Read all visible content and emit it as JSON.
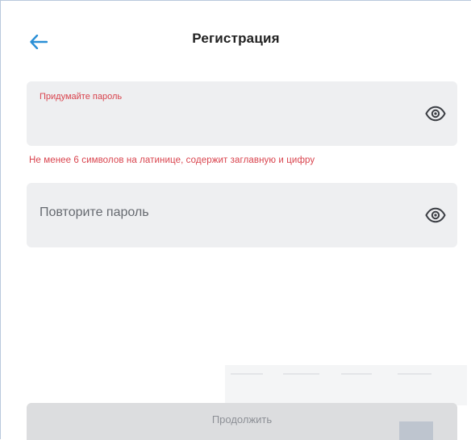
{
  "header": {
    "title": "Регистрация"
  },
  "password_field": {
    "label": "Придумайте пароль",
    "value": ""
  },
  "hint": {
    "text": "Не менее 6 символов на латинице, содержит заглавную и цифру"
  },
  "repeat_field": {
    "placeholder": "Повторите пароль",
    "value": ""
  },
  "continue_button": {
    "label": "Продолжить"
  },
  "colors": {
    "accent": "#2a8fd6",
    "error": "#d9434d",
    "field_bg": "#eeeff1",
    "button_disabled_bg": "#dcdddf",
    "button_disabled_text": "#8d9096"
  },
  "icons": {
    "back": "arrow-left-icon",
    "eye": "eye-icon"
  }
}
